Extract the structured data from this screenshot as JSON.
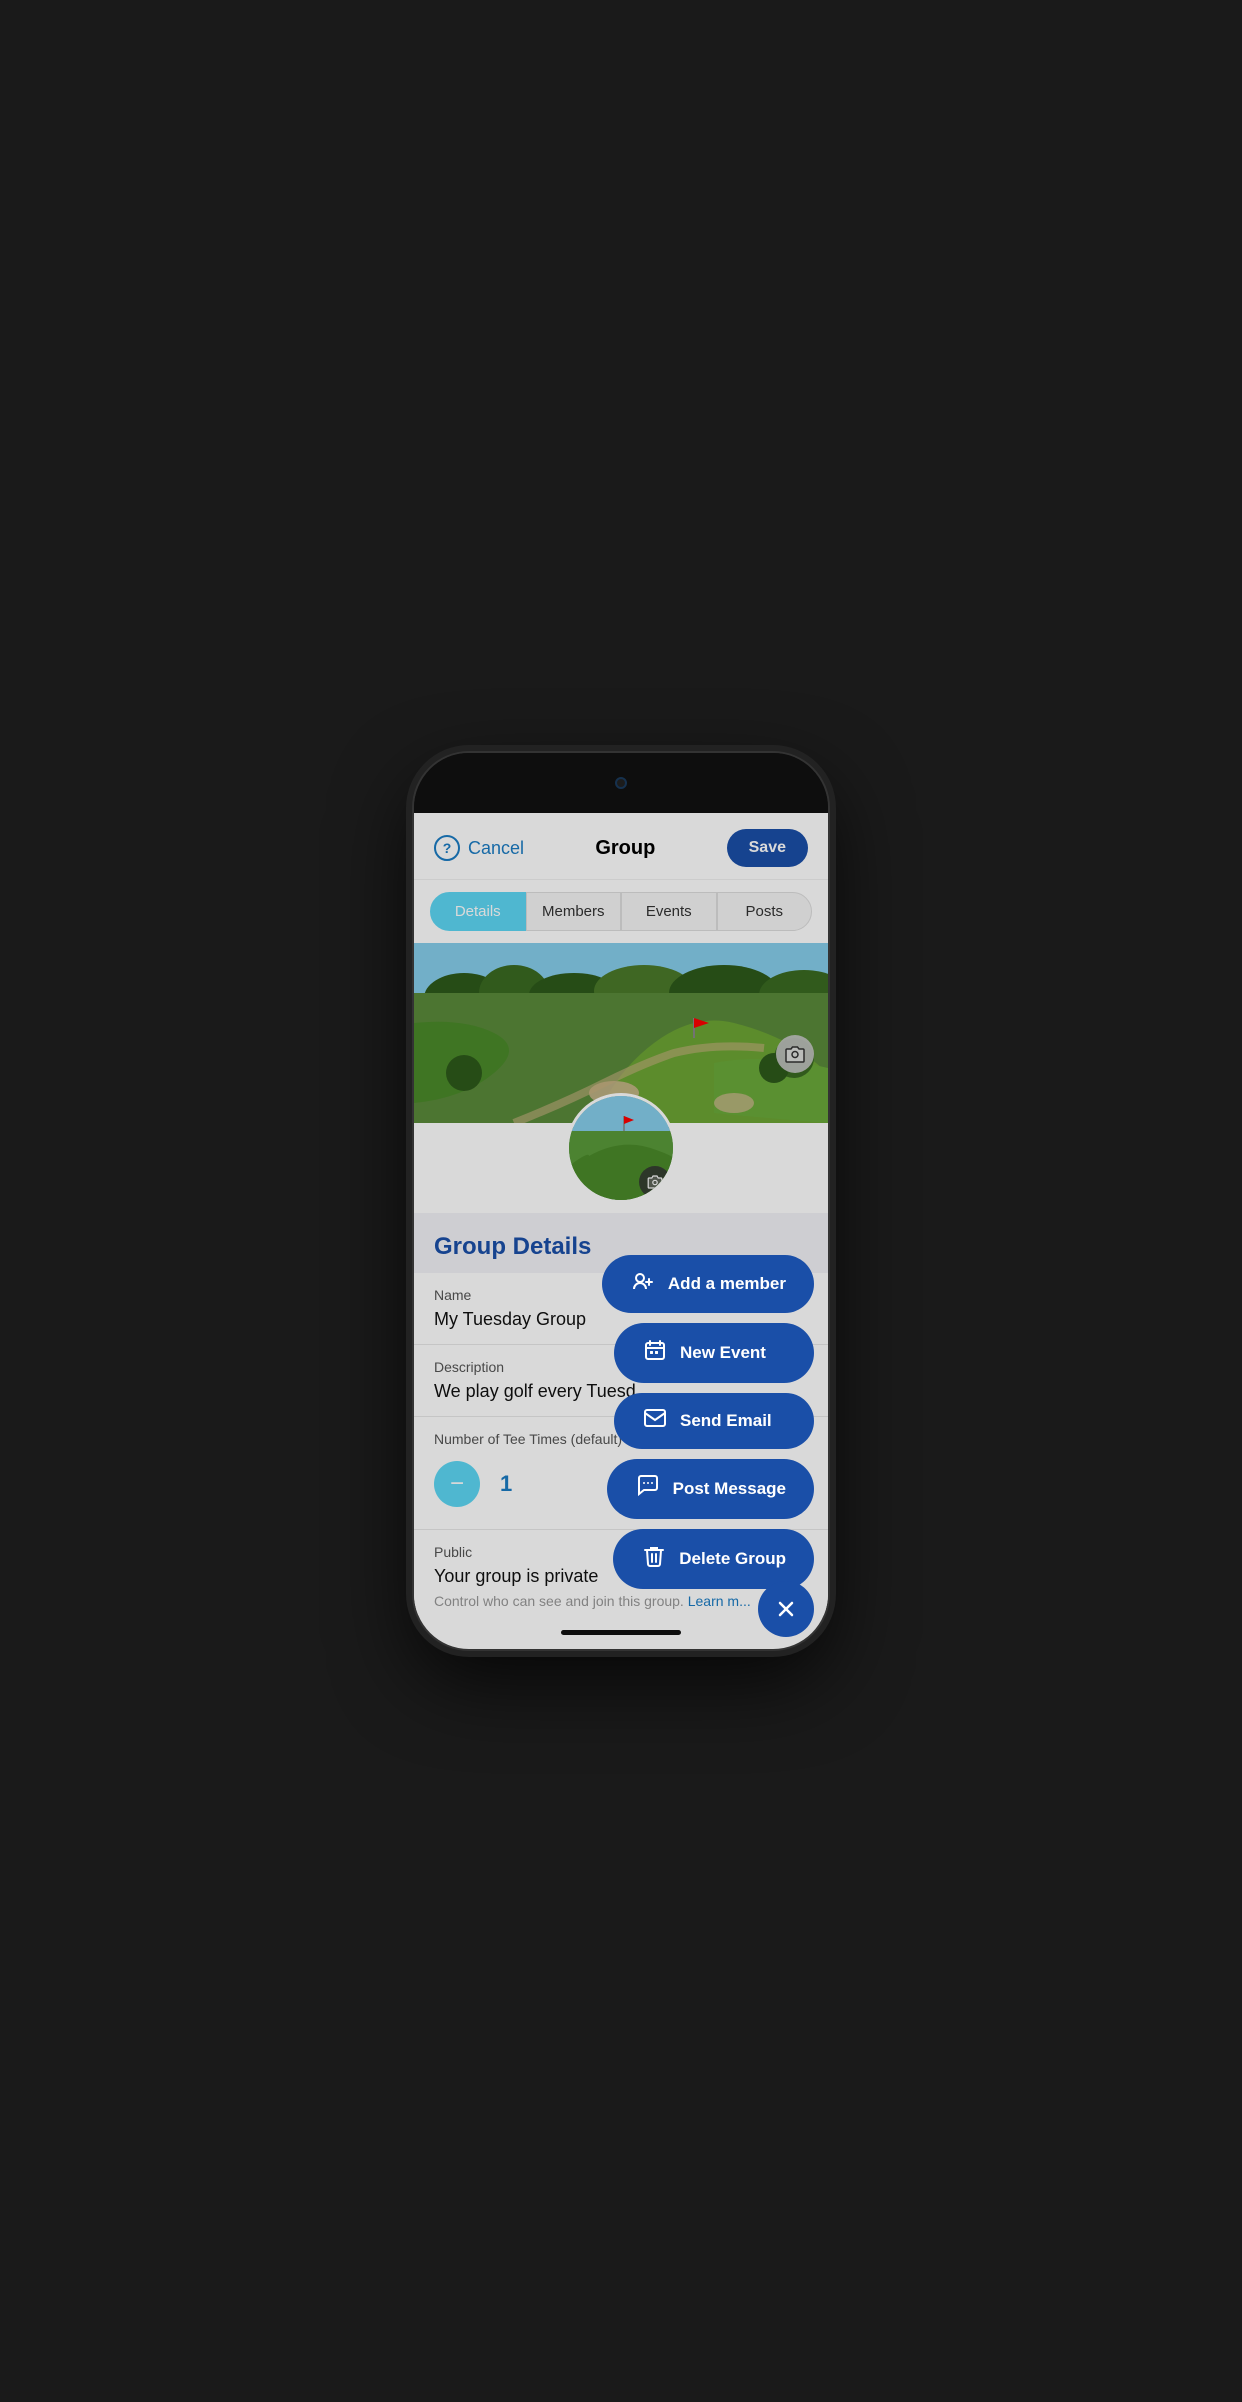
{
  "header": {
    "cancel_label": "Cancel",
    "title": "Group",
    "save_label": "Save",
    "help_icon": "?"
  },
  "tabs": [
    {
      "label": "Details",
      "active": true
    },
    {
      "label": "Members",
      "active": false
    },
    {
      "label": "Events",
      "active": false
    },
    {
      "label": "Posts",
      "active": false
    }
  ],
  "group_details": {
    "section_title": "Group Details",
    "name_label": "Name",
    "name_value": "My Tuesday Group",
    "description_label": "Description",
    "description_value": "We play golf every Tuesd...",
    "tee_times_label": "Number of Tee Times (default)",
    "tee_times_value": "1",
    "public_label": "Public",
    "public_value": "Your group is private",
    "hint_text": "Control who can see and join this group.",
    "learn_more_label": "Learn m..."
  },
  "action_menu": {
    "add_member_label": "Add a member",
    "new_event_label": "New Event",
    "send_email_label": "Send Email",
    "post_message_label": "Post Message",
    "delete_group_label": "Delete Group",
    "close_label": "×"
  },
  "icons": {
    "camera": "📷",
    "add_member": "👤+",
    "calendar": "📅",
    "envelope": "✉",
    "chat": "💬",
    "trash": "🗑",
    "close": "✕"
  }
}
